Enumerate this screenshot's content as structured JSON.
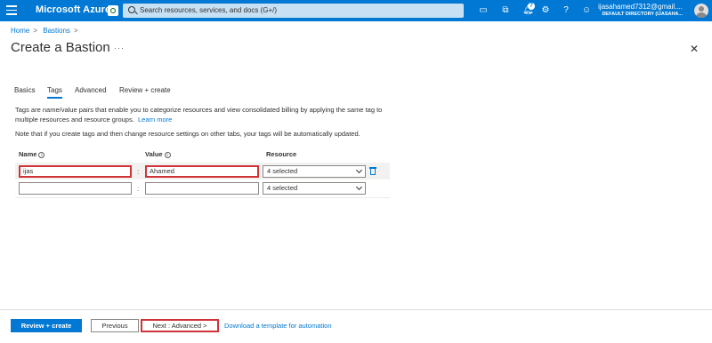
{
  "topbar": {
    "brand": "Microsoft Azure",
    "search_placeholder": "Search resources, services, and docs (G+/)",
    "notification_count": "7",
    "account_name": "ijasahamed7312@gmail....",
    "account_directory": "DEFAULT DIRECTORY (IJASAHA...",
    "colors": {
      "bar": "#0078d4",
      "search": "#c7e0f4"
    },
    "icons": [
      "hamburger-icon",
      "copilot-icon",
      "search-icon",
      "cloud-shell-icon",
      "directory-filter-icon",
      "notifications-icon",
      "settings-icon",
      "help-icon",
      "feedback-icon",
      "avatar"
    ]
  },
  "breadcrumb": {
    "items": [
      "Home",
      "Bastions"
    ],
    "separator": ">"
  },
  "page": {
    "title": "Create a Bastion",
    "more": "···",
    "close": "✕"
  },
  "tabs": [
    {
      "label": "Basics",
      "active": false
    },
    {
      "label": "Tags",
      "active": true
    },
    {
      "label": "Advanced",
      "active": false
    },
    {
      "label": "Review + create",
      "active": false
    }
  ],
  "description": {
    "text": "Tags are name/value pairs that enable you to categorize resources and view consolidated billing by applying the same tag to multiple resources and resource groups.",
    "link": "Learn more",
    "note": "Note that if you create tags and then change resource settings on other tabs, your tags will be automatically updated."
  },
  "tag_table": {
    "headers": {
      "name": "Name",
      "value": "Value",
      "resource": "Resource",
      "info": "i"
    },
    "separator": ":",
    "rows": [
      {
        "name": "ijas",
        "value": "Ahamed",
        "resource": "4 selected",
        "highlighted": true
      },
      {
        "name": "",
        "value": "",
        "resource": "4 selected",
        "highlighted": false
      }
    ]
  },
  "footer": {
    "review_create": "Review + create",
    "previous": "Previous",
    "next": "Next : Advanced >",
    "download_link": "Download a template for automation"
  },
  "colors": {
    "accent": "#0078d4",
    "highlight": "#d13438",
    "text": "#323130"
  }
}
